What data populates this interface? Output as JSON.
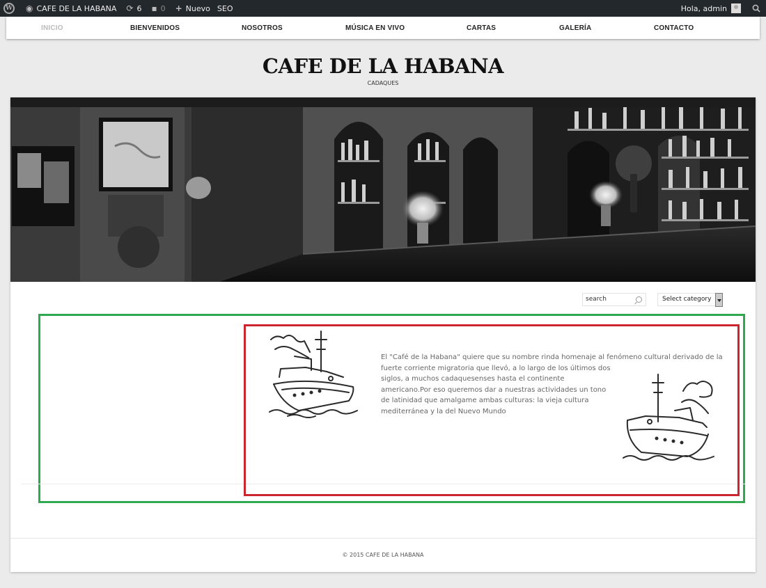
{
  "adminbar": {
    "site_name": "CAFE DE LA HABANA",
    "updates_count": "6",
    "comments_count": "0",
    "new_label": "Nuevo",
    "seo_label": "SEO",
    "greeting": "Hola, admin"
  },
  "nav": {
    "items": [
      {
        "label": "INICIO",
        "active": true
      },
      {
        "label": "BIENVENIDOS"
      },
      {
        "label": "NOSOTROS"
      },
      {
        "label": "MÚSICA EN VIVO"
      },
      {
        "label": "CARTAS"
      },
      {
        "label": "GALERÍA"
      },
      {
        "label": "CONTACTO"
      }
    ]
  },
  "site": {
    "title": "CAFE DE LA HABANA",
    "description": "CADAQUES"
  },
  "widgets": {
    "search_value": "search",
    "category_select": "Select category"
  },
  "content": {
    "text_lines": [
      "El \"Café de la Habana\" quiere que su nombre rinda homenaje al fenómeno cultural derivado de la",
      "fuerte corriente migratoria que llevó, a lo largo de los últimos dos",
      "siglos, a muchos cadaquesenses hasta el continente",
      "americano.Por eso queremos dar a nuestras actividades un tono",
      "de latinidad que amalgame ambas culturas: la vieja cultura",
      "mediterránea y la del Nuevo Mundo"
    ]
  },
  "footer": {
    "text": "© 2015 CAFE DE LA HABANA"
  },
  "colors": {
    "adminbar_bg": "#23282d",
    "highlight_green": "#2fa84f",
    "highlight_red": "#cc2530",
    "nav_active": "#bbbbbb"
  }
}
